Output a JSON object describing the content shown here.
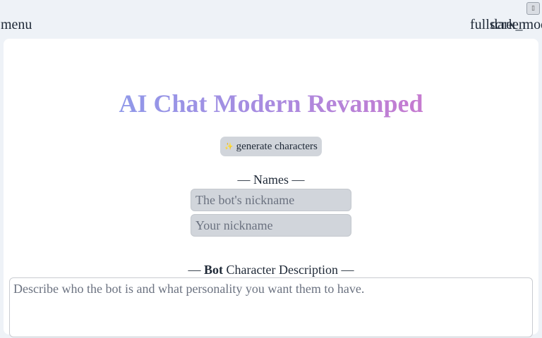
{
  "topbar": {
    "menu_label": "menu",
    "tiny_button_icon": "square-icon",
    "fullscreen_label": "fullscreen",
    "darkmode_label": "dark_mode"
  },
  "main": {
    "title": "AI Chat Modern Revamped",
    "generate_button": {
      "icon": "sparkle-icon",
      "icon_glyph": "✨",
      "label": "generate characters"
    },
    "names_section": {
      "label": "— Names —",
      "bot_nickname_placeholder": "The bot's nickname",
      "user_nickname_placeholder": "Your nickname"
    },
    "description_section": {
      "label_prefix": "— ",
      "label_bold": "Bot",
      "label_suffix": " Character Description —",
      "placeholder": "Describe who the bot is and what personality you want them to have."
    }
  },
  "colors": {
    "page_bg": "#eef2f7",
    "card_bg": "#ffffff",
    "title_gradient": [
      "#7da3f0",
      "#a98be0",
      "#dc6fc4"
    ],
    "input_bg": "#d1d5db"
  }
}
